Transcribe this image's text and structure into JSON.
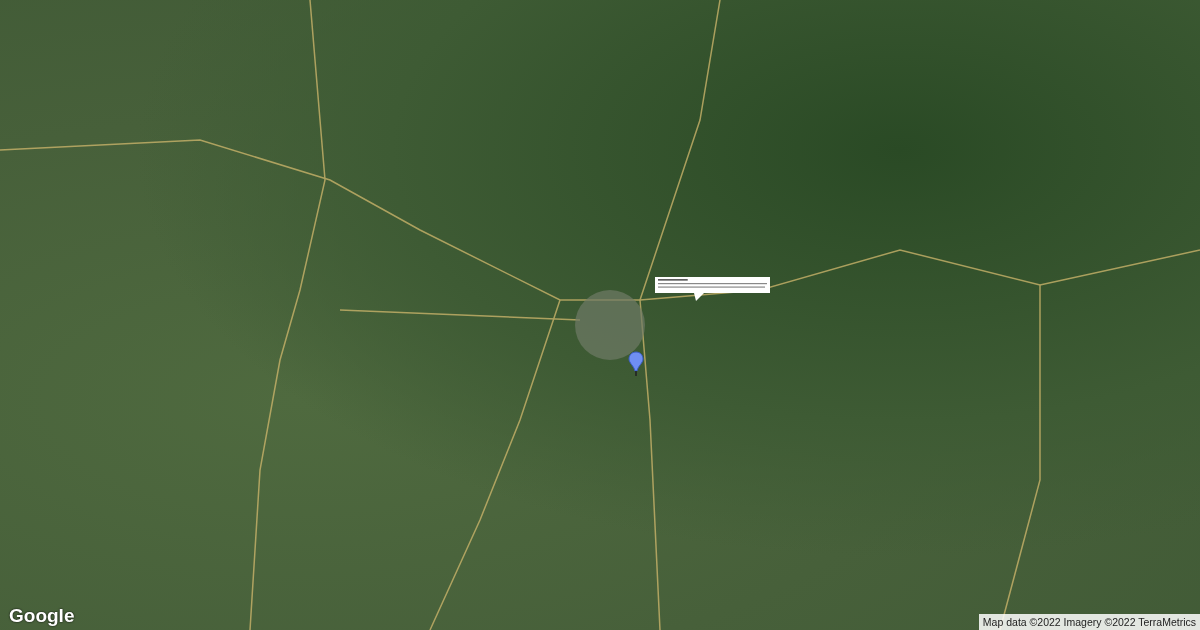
{
  "map": {
    "logo": "Google",
    "attribution": "Map data ©2022 Imagery ©2022 TerraMetrics"
  }
}
